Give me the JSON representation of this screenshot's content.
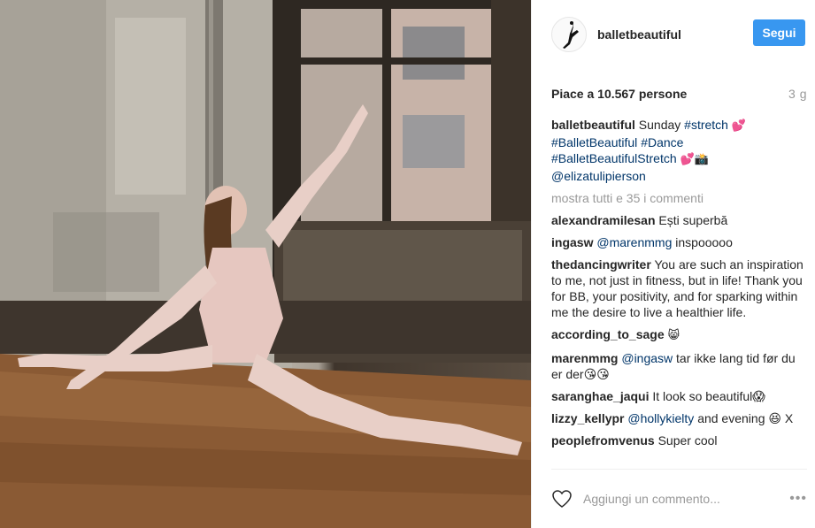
{
  "post": {
    "username": "balletbeautiful",
    "follow_label": "Segui",
    "likes_text": "Piace a 10.567 persone",
    "time_ago": "3 g"
  },
  "caption": {
    "username": "balletbeautiful",
    "text": "Sunday",
    "tags": [
      "#stretch",
      "#BalletBeautiful",
      "#Dance",
      "#BalletBeautifulStretch",
      "@elizatulipierson"
    ]
  },
  "show_all_label": "mostra tutti e 35 i commenti",
  "comments": [
    {
      "user": "alexandramilesan",
      "text": "Ești superbă"
    },
    {
      "user": "ingasw",
      "mention": "@marenmmg",
      "text": "inspooooo"
    },
    {
      "user": "thedancingwriter",
      "text": "You are such an inspiration to me, not just in fitness, but in life! Thank you for BB, your positivity, and for sparking within me the desire to live a healthier life."
    },
    {
      "user": "according_to_sage",
      "text": "😸"
    },
    {
      "user": "marenmmg",
      "mention": "@ingasw",
      "text": "tar ikke lang tid før du er der😘😘"
    },
    {
      "user": "saranghae_jaqui",
      "text": "It look so beautiful😱"
    },
    {
      "user": "lizzy_kellypr",
      "mention": "@hollykielty",
      "text": "and evening 😆 X"
    },
    {
      "user": "peoplefromvenus",
      "text": "Super cool"
    }
  ],
  "composer": {
    "placeholder": "Aggiungi un commento...",
    "more_label": "•••"
  },
  "colors": {
    "link": "#003569",
    "button": "#3897f0",
    "muted": "#999999"
  }
}
